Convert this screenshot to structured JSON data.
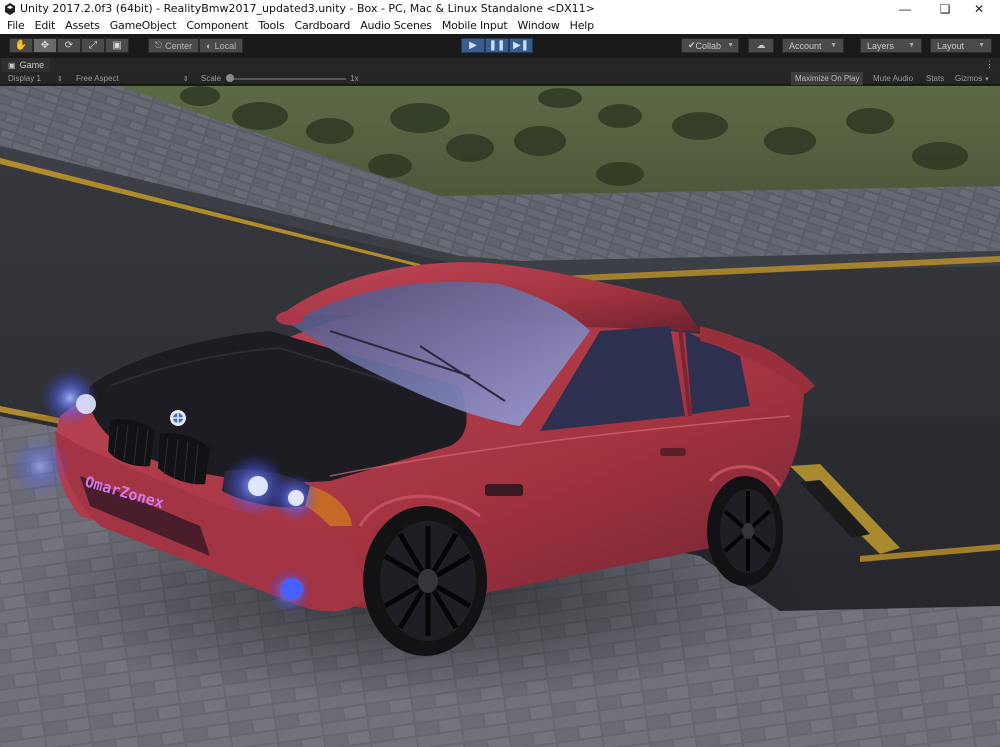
{
  "window": {
    "title": "Unity 2017.2.0f3 (64bit) - RealityBmw2017_updated3.unity - Box - PC, Mac & Linux Standalone <DX11>",
    "icon": "unity-logo-icon"
  },
  "menu": [
    "File",
    "Edit",
    "Assets",
    "GameObject",
    "Component",
    "Tools",
    "Cardboard",
    "Audio Scenes",
    "Mobile Input",
    "Window",
    "Help"
  ],
  "toolbar": {
    "tools": [
      "hand-icon",
      "move-icon",
      "rotate-icon",
      "scale-icon",
      "rect-icon"
    ],
    "pivot_label": "Center",
    "space_label": "Local",
    "play": [
      "play-icon",
      "pause-icon",
      "step-icon"
    ],
    "collab_label": "Collab",
    "account_label": "Account",
    "layers_label": "Layers",
    "layout_label": "Layout"
  },
  "game_tab": {
    "label": "Game",
    "display": "Display 1",
    "aspect": "Free Aspect",
    "scale_label": "Scale",
    "scale_value": "1x",
    "maximize_label": "Maximize On Play",
    "mute_label": "Mute Audio",
    "stats_label": "Stats",
    "gizmos_label": "Gizmos"
  },
  "scene": {
    "plate_text": "OmarZonex",
    "colors": {
      "car_body": "#b03a48",
      "hood": "#1c1c22",
      "road": "#3a3c42",
      "grass": "#4d5a3a",
      "curb": "#5c5e66",
      "lights": "#6a7cff",
      "stripe": "#c79a2a"
    }
  }
}
